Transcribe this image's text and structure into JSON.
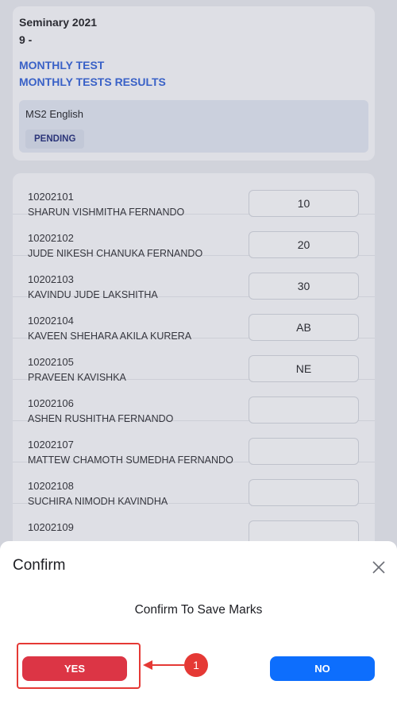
{
  "header": {
    "title": "Seminary 2021",
    "subtitle": "9 -",
    "links": [
      "MONTHLY TEST",
      "MONTHLY TESTS RESULTS"
    ],
    "subject": "MS2 English",
    "status": "PENDING"
  },
  "students": [
    {
      "id": "10202101",
      "name": "SHARUN VISHMITHA FERNANDO",
      "mark": "10"
    },
    {
      "id": "10202102",
      "name": "JUDE NIKESH CHANUKA FERNANDO",
      "mark": "20"
    },
    {
      "id": "10202103",
      "name": "KAVINDU JUDE LAKSHITHA",
      "mark": "30"
    },
    {
      "id": "10202104",
      "name": "KAVEEN SHEHARA AKILA KURERA",
      "mark": "AB"
    },
    {
      "id": "10202105",
      "name": "PRAVEEN KAVISHKA",
      "mark": "NE"
    },
    {
      "id": "10202106",
      "name": "ASHEN RUSHITHA FERNANDO",
      "mark": ""
    },
    {
      "id": "10202107",
      "name": "MATTEW CHAMOTH SUMEDHA FERNANDO",
      "mark": ""
    },
    {
      "id": "10202108",
      "name": "SUCHIRA NIMODH KAVINDHA",
      "mark": ""
    },
    {
      "id": "10202109",
      "name": "",
      "mark": ""
    }
  ],
  "modal": {
    "title": "Confirm",
    "message": "Confirm To Save Marks",
    "yes_label": "YES",
    "no_label": "NO"
  },
  "annotation": {
    "step": "1",
    "color": "#e53935"
  },
  "colors": {
    "link": "#2f5fd4",
    "yes_button": "#dc3545",
    "no_button": "#0d6efd",
    "badge_text": "#1e2a78"
  }
}
